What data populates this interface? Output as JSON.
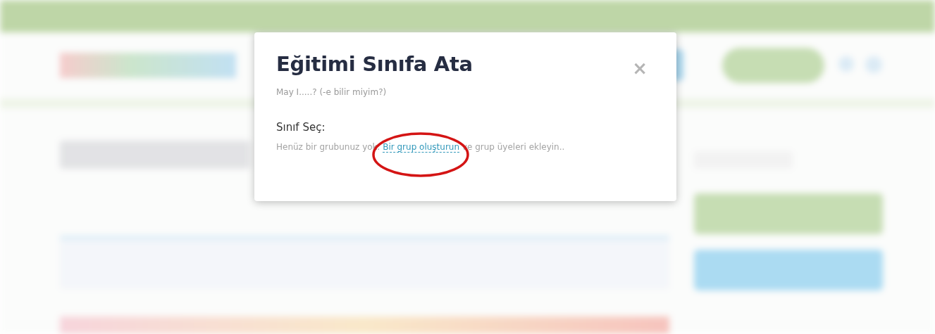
{
  "dialog": {
    "title": "Eğitimi Sınıfa Ata",
    "close": "×",
    "subtitle": "May I.....? (-e bilir miyim?)",
    "section_label": "Sınıf Seç:",
    "message_before": "Henüz bir grubunuz yok.",
    "link": "Bir grup oluşturun",
    "message_after": "ve grup üyeleri ekleyin..",
    "link_circled": true
  }
}
